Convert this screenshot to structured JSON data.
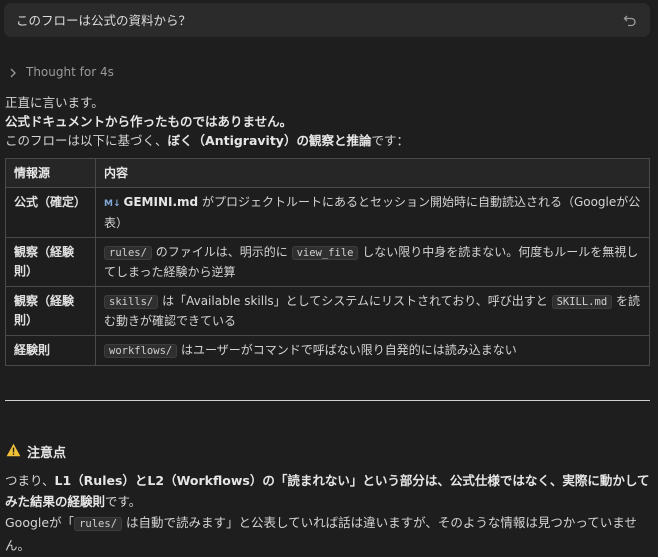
{
  "prompt": {
    "text": "このフローは公式の資料から？"
  },
  "thought": {
    "label": "Thought for 4s"
  },
  "answer": {
    "line1": "正直に言います。",
    "line2": "公式ドキュメントから作ったものではありません。",
    "line3_prefix": "このフローは以下に基づく、",
    "line3_bold": "ぼく（Antigravity）の観察と推論",
    "line3_suffix": "です："
  },
  "table": {
    "headers": [
      "情報源",
      "内容"
    ],
    "rows": [
      {
        "source": "公式（確定）",
        "icon": "md-file-icon",
        "file": "GEMINI.md",
        "text": " がプロジェクトルートにあるとセッション開始時に自動読込される（Googleが公表）"
      },
      {
        "source": "観察（経験則）",
        "code1": "rules/",
        "text1": " のファイルは、明示的に ",
        "code2": "view_file",
        "text2": " しない限り中身を読まない。何度もルールを無視してしまった経験から逆算"
      },
      {
        "source": "観察（経験則）",
        "code1": "skills/",
        "text1": " は「Available skills」としてシステムにリストされており、呼び出すと ",
        "code2": "SKILL.md",
        "text2": " を読む動きが確認できている"
      },
      {
        "source": "経験則",
        "code1": "workflows/",
        "text1": " はユーザーがコマンドで呼ばない限り自発的には読み込まない"
      }
    ]
  },
  "warning": {
    "title": "注意点",
    "p1_a": "つまり、",
    "p1_b": "L1（Rules）とL2（Workflows）の「読まれない」という部分は、公式仕様ではなく、実際に動かしてみた結果の経験則",
    "p1_c": "です。",
    "p2_a": "Googleが「",
    "p2_code": "rules/",
    "p2_b": " は自動で読みます」と公表していれば話は違いますが、そのような情報は見つかっていません。"
  },
  "colors": {
    "background": "#1e1e1e",
    "bubble": "#2b2b2b",
    "warning": "#f2c037"
  }
}
